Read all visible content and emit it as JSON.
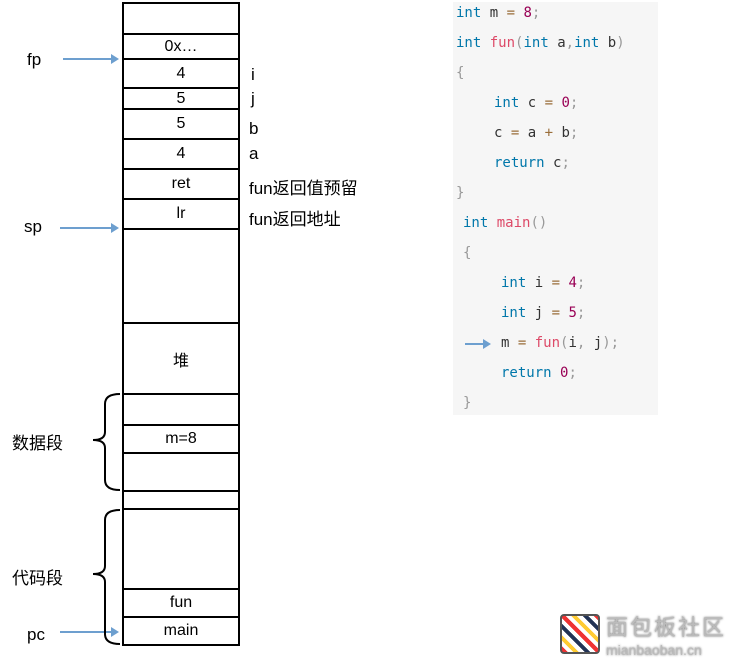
{
  "stack": {
    "cells": [
      "",
      "0x…",
      "4",
      "5",
      "5",
      "4",
      "ret",
      "lr",
      "",
      "堆",
      "",
      "m=8",
      "",
      "",
      "",
      "fun",
      "main"
    ],
    "side_labels": [
      "i",
      "j",
      "b",
      "a",
      "fun返回值预留",
      "fun返回地址"
    ]
  },
  "pointers": {
    "fp": "fp",
    "sp": "sp",
    "pc": "pc"
  },
  "segments": {
    "data": "数据段",
    "code": "代码段"
  },
  "code": {
    "lines": [
      "int m = 8;",
      "int fun(int a,int b)",
      "{",
      "int c = 0;",
      "c = a + b;",
      "return c;",
      "}",
      "int main()",
      "{",
      "int i = 4;",
      "int j = 5;",
      "m = fun(i, j);",
      "return 0;",
      "}"
    ]
  },
  "logo": {
    "name": "面包板社区",
    "domain": "mianbaoban.cn"
  },
  "colors": {
    "arrow": "#6d9fcf",
    "keyword": "#0077aa",
    "function": "#dd4a68",
    "number": "#990055"
  }
}
